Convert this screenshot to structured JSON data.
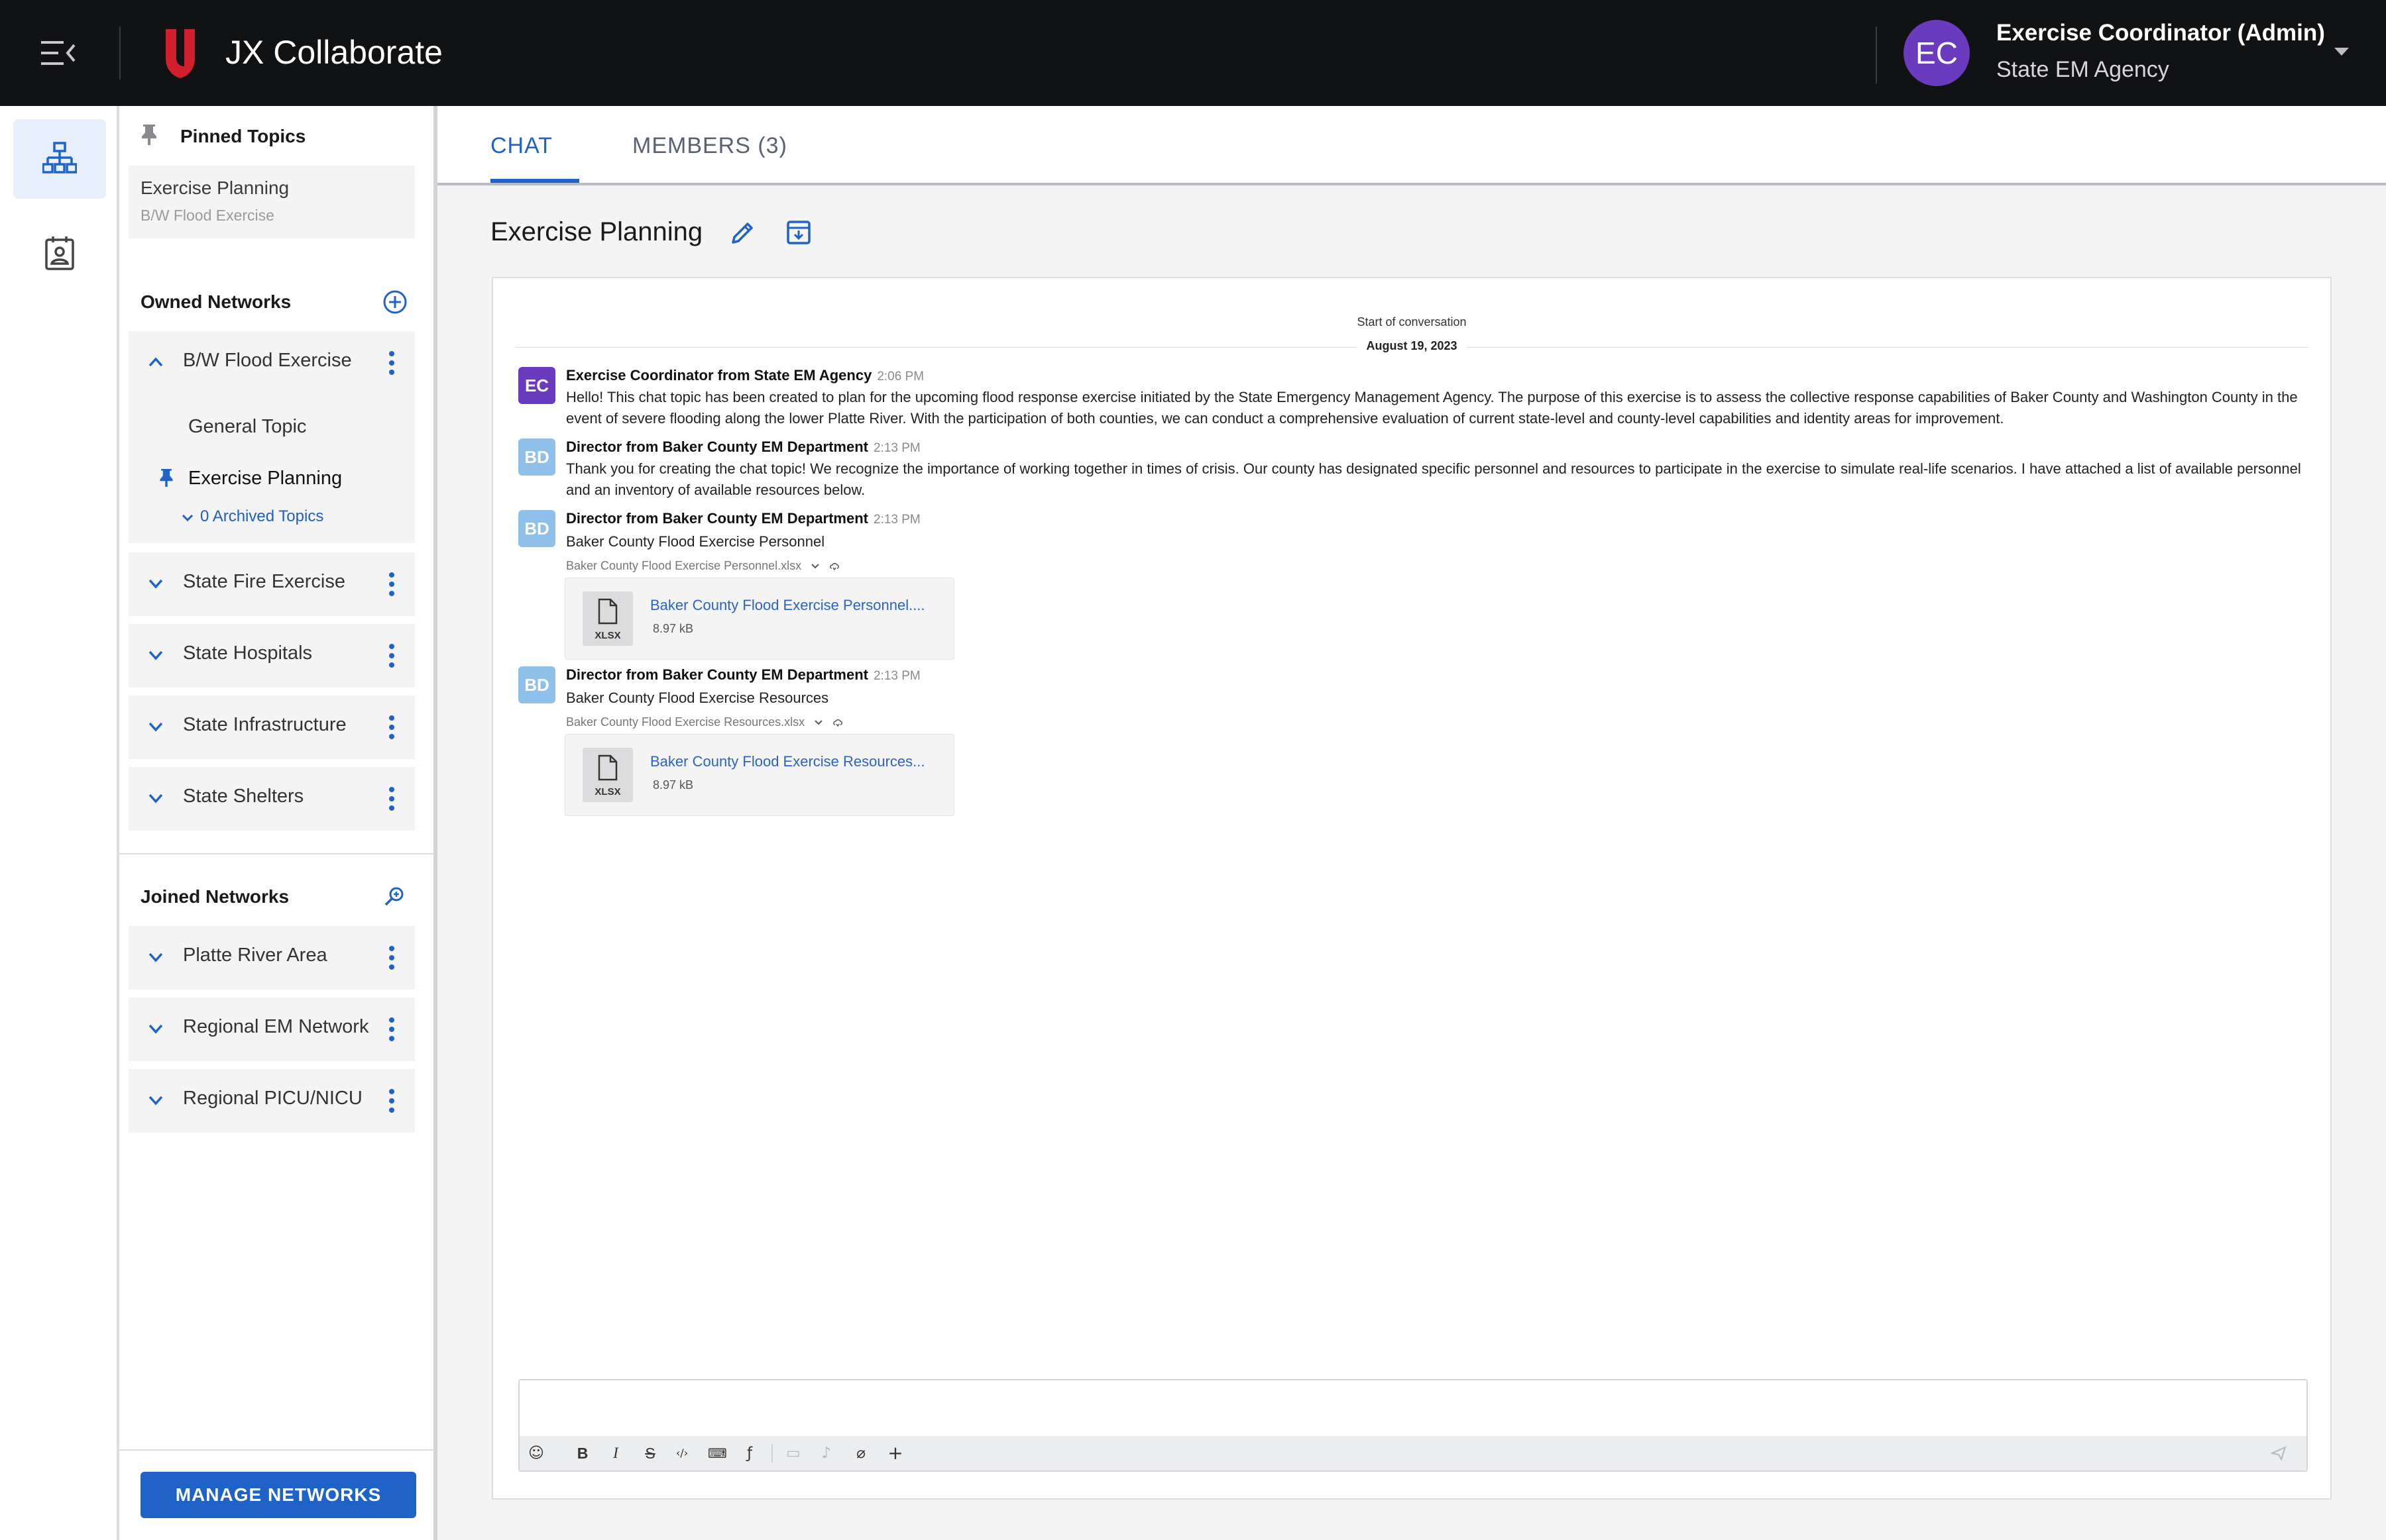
{
  "app": {
    "title": "JX Collaborate",
    "accent_color": "#1f63c7",
    "brand_color": "#d0202e"
  },
  "user": {
    "initials": "EC",
    "name": "Exercise Coordinator (Admin)",
    "agency": "State EM Agency"
  },
  "rail": {
    "items": [
      {
        "icon": "network-icon",
        "active": true
      },
      {
        "icon": "contacts-icon",
        "active": false
      }
    ]
  },
  "sidebar": {
    "pinned": {
      "label": "Pinned Topics",
      "items": [
        {
          "title": "Exercise Planning",
          "network": "B/W Flood Exercise"
        }
      ]
    },
    "owned": {
      "label": "Owned Networks",
      "networks": [
        {
          "label": "B/W Flood Exercise",
          "expanded": true,
          "topics": [
            "General Topic",
            "Exercise Planning"
          ],
          "archived_label": "0 Archived Topics"
        },
        {
          "label": "State Fire Exercise",
          "expanded": false
        },
        {
          "label": "State Hospitals",
          "expanded": false
        },
        {
          "label": "State Infrastructure",
          "expanded": false
        },
        {
          "label": "State Shelters",
          "expanded": false
        }
      ]
    },
    "joined": {
      "label": "Joined Networks",
      "networks": [
        {
          "label": "Platte River Area"
        },
        {
          "label": "Regional EM Network"
        },
        {
          "label": "Regional PICU/NICU"
        }
      ]
    },
    "manage_button": "MANAGE NETWORKS"
  },
  "tabs": [
    {
      "label": "CHAT",
      "active": true
    },
    {
      "label": "MEMBERS (3)",
      "active": false
    }
  ],
  "topic": {
    "title": "Exercise Planning"
  },
  "conversation": {
    "start_label": "Start of conversation",
    "date": "August 19, 2023",
    "messages": [
      {
        "initials": "EC",
        "sender": "Exercise Coordinator from State EM Agency",
        "time": "2:06 PM",
        "text": "Hello! This chat topic has been created to plan for the upcoming flood response exercise initiated by the State Emergency Management Agency. The purpose of this exercise is to assess the collective response capabilities of Baker County and Washington County in the event of severe flooding along the lower Platte River. With the participation of both counties, we can conduct a comprehensive evaluation of current state-level and county-level capabilities and identity areas for improvement."
      },
      {
        "initials": "BD",
        "sender": "Director from Baker County EM Department",
        "time": "2:13 PM",
        "text": "Thank you for creating the chat topic! We recognize the importance of working together in times of crisis. Our county has designated specific personnel and resources to participate in the exercise to simulate real-life scenarios. I have attached a list of available personnel and an inventory of available resources below."
      },
      {
        "initials": "BD",
        "sender": "Director from Baker County EM Department",
        "time": "2:13 PM",
        "text": "Baker County Flood Exercise Personnel",
        "attachment": {
          "filename": "Baker County Flood Exercise Personnel.xlsx",
          "display_name": "Baker County Flood Exercise Personnel....",
          "ext": "XLSX",
          "size": "8.97 kB"
        }
      },
      {
        "initials": "BD",
        "sender": "Director from Baker County EM Department",
        "time": "2:13 PM",
        "text": "Baker County Flood Exercise Resources",
        "attachment": {
          "filename": "Baker County Flood Exercise Resources.xlsx",
          "display_name": "Baker County Flood Exercise Resources...",
          "ext": "XLSX",
          "size": "8.97 kB"
        }
      }
    ]
  },
  "composer": {
    "placeholder": "",
    "tools": [
      {
        "name": "emoji-icon",
        "glyph": "☺"
      },
      {
        "name": "bold-icon",
        "glyph": "B"
      },
      {
        "name": "italic-icon",
        "glyph": "I"
      },
      {
        "name": "strikethrough-icon",
        "glyph": "S"
      },
      {
        "name": "code-icon",
        "glyph": "‹/›"
      },
      {
        "name": "code-block-icon",
        "glyph": "⌨"
      },
      {
        "name": "formula-icon",
        "glyph": "ƒ"
      },
      {
        "name": "video-icon",
        "glyph": "▭"
      },
      {
        "name": "mic-icon",
        "glyph": "♪"
      },
      {
        "name": "attach-icon",
        "glyph": "⌀"
      },
      {
        "name": "plus-icon",
        "glyph": "+"
      }
    ]
  }
}
